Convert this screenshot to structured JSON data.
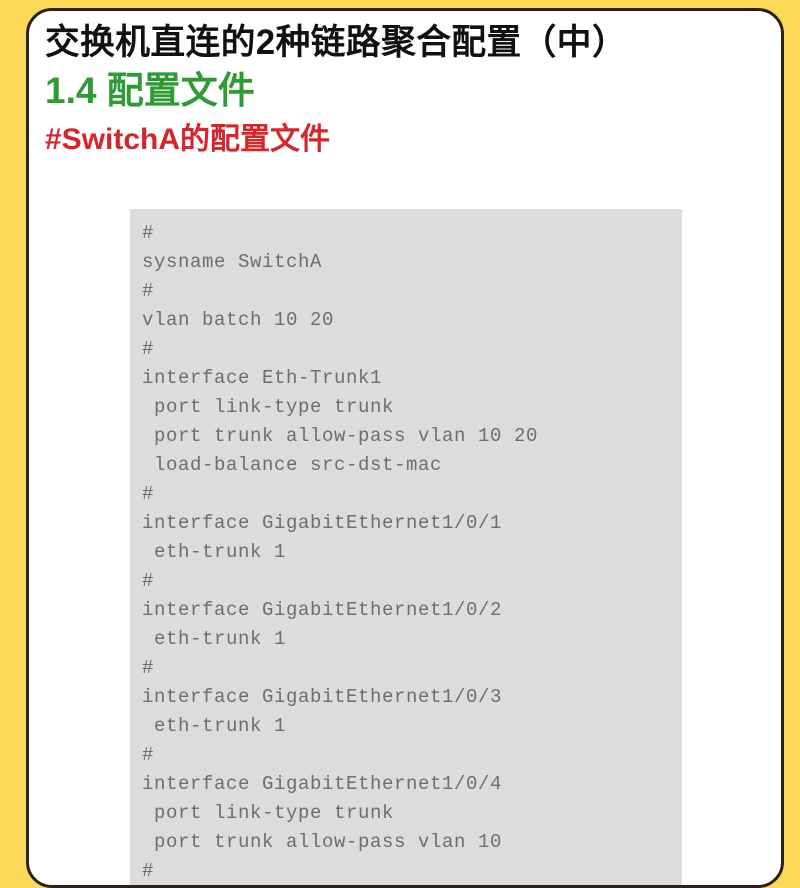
{
  "theme": {
    "page_background": "#fdd958",
    "card_background": "#ffffff",
    "card_border": "#2b2118",
    "title_color": "#111111",
    "green_heading_color": "#2e9b34",
    "red_heading_color": "#d8252a",
    "code_panel_background": "#dcdcdc",
    "code_text_color": "#6e6e6e"
  },
  "header": {
    "title": "交换机直连的2种链路聚合配置（中）",
    "section_heading": "1.4 配置文件",
    "comment_heading": "#SwitchA的配置文件"
  },
  "code_block": {
    "language": "huawei-vrp-config",
    "device": "SwitchA",
    "lines": [
      "#",
      "sysname SwitchA",
      "#",
      "vlan batch 10 20",
      "#",
      "interface Eth-Trunk1",
      " port link-type trunk",
      " port trunk allow-pass vlan 10 20",
      " load-balance src-dst-mac",
      "#",
      "interface GigabitEthernet1/0/1",
      " eth-trunk 1",
      "#",
      "interface GigabitEthernet1/0/2",
      " eth-trunk 1",
      "#",
      "interface GigabitEthernet1/0/3",
      " eth-trunk 1",
      "#",
      "interface GigabitEthernet1/0/4",
      " port link-type trunk",
      " port trunk allow-pass vlan 10",
      "#"
    ]
  }
}
